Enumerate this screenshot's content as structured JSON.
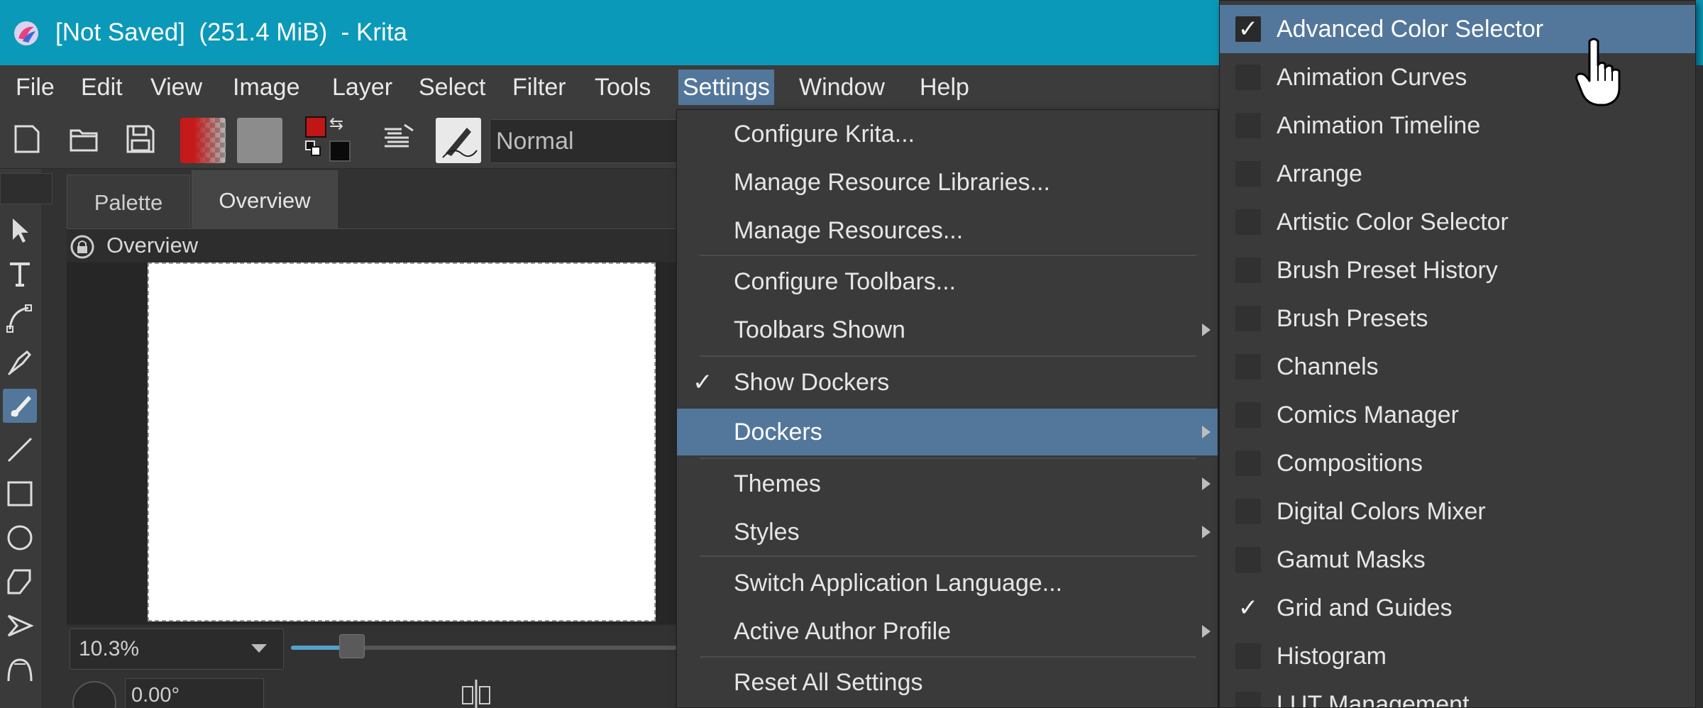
{
  "window": {
    "title": "[Not Saved]  (251.4 MiB)  - Krita",
    "title_bar_color": "#0b99b9",
    "menu_highlight_color": "#53779b"
  },
  "menubar": {
    "items": [
      "File",
      "Edit",
      "View",
      "Image",
      "Layer",
      "Select",
      "Filter",
      "Tools",
      "Settings",
      "Window",
      "Help"
    ],
    "active": "Settings"
  },
  "toolbar": {
    "icons": [
      "new-document-icon",
      "open-folder-icon",
      "save-icon",
      "gradient-swatch",
      "pattern-swatch",
      "foreground-color",
      "background-color",
      "swap-colors-icon",
      "reset-colors-icon",
      "edit-brush-settings-icon",
      "brush-preset-preview"
    ],
    "foreground_color": "#c01616",
    "background_color": "#0a0a0a",
    "blend_mode": "Normal"
  },
  "toolbox": {
    "tools": [
      "select-shapes-icon",
      "text-tool-icon",
      "edit-shapes-icon",
      "calligraphy-icon",
      "freehand-brush-icon",
      "line-tool-icon",
      "rectangle-tool-icon",
      "ellipse-tool-icon",
      "polygon-tool-icon",
      "polyline-tool-icon",
      "bezier-curve-icon"
    ],
    "active": "freehand-brush-icon"
  },
  "dock": {
    "tabs": [
      "Palette",
      "Overview"
    ],
    "active_tab": "Overview",
    "panel_title": "Overview",
    "zoom_value": "10.3%",
    "zoom_fraction": 0.1,
    "rotation_value": "0.00°"
  },
  "settings_menu": {
    "items": [
      {
        "label": "Configure Krita...",
        "check": "",
        "submenu": false
      },
      {
        "label": "Manage Resource Libraries...",
        "check": "",
        "submenu": false
      },
      {
        "label": "Manage Resources...",
        "check": "",
        "submenu": false
      },
      {
        "label": "Configure Toolbars...",
        "check": "",
        "submenu": false
      },
      {
        "label": "Toolbars Shown",
        "check": "",
        "submenu": true
      },
      {
        "label": "Show Dockers",
        "check": "✓",
        "submenu": false
      },
      {
        "label": "Dockers",
        "check": "",
        "submenu": true
      },
      {
        "label": "Themes",
        "check": "",
        "submenu": true
      },
      {
        "label": "Styles",
        "check": "",
        "submenu": true
      },
      {
        "label": "Switch Application Language...",
        "check": "",
        "submenu": false
      },
      {
        "label": "Active Author Profile",
        "check": "",
        "submenu": true
      },
      {
        "label": "Reset All Settings",
        "check": "",
        "submenu": false
      }
    ],
    "highlighted": "Dockers"
  },
  "dockers_menu": {
    "items": [
      {
        "label": "Advanced Color Selector",
        "check": "✓"
      },
      {
        "label": "Animation Curves",
        "check": ""
      },
      {
        "label": "Animation Timeline",
        "check": ""
      },
      {
        "label": "Arrange",
        "check": ""
      },
      {
        "label": "Artistic Color Selector",
        "check": ""
      },
      {
        "label": "Brush Preset History",
        "check": ""
      },
      {
        "label": "Brush Presets",
        "check": ""
      },
      {
        "label": "Channels",
        "check": ""
      },
      {
        "label": "Comics Manager",
        "check": ""
      },
      {
        "label": "Compositions",
        "check": ""
      },
      {
        "label": "Digital Colors Mixer",
        "check": ""
      },
      {
        "label": "Gamut Masks",
        "check": ""
      },
      {
        "label": "Grid and Guides",
        "check": "✓"
      },
      {
        "label": "Histogram",
        "check": ""
      },
      {
        "label": "LUT Management",
        "check": ""
      }
    ],
    "highlighted": "Advanced Color Selector"
  }
}
